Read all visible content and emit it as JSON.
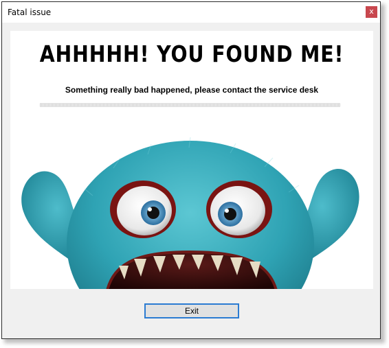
{
  "window": {
    "title": "Fatal issue",
    "close_label": "x"
  },
  "content": {
    "headline": "AHHHHH! YOU FOUND ME!",
    "message": "Something really bad happened, please contact the service desk",
    "image": "furry-teal-monster-illustration"
  },
  "buttons": {
    "exit_label": "Exit"
  },
  "colors": {
    "close_button": "#c8474e",
    "exit_button_border": "#2b7bd2",
    "monster_fur": "#2fa3b4"
  }
}
